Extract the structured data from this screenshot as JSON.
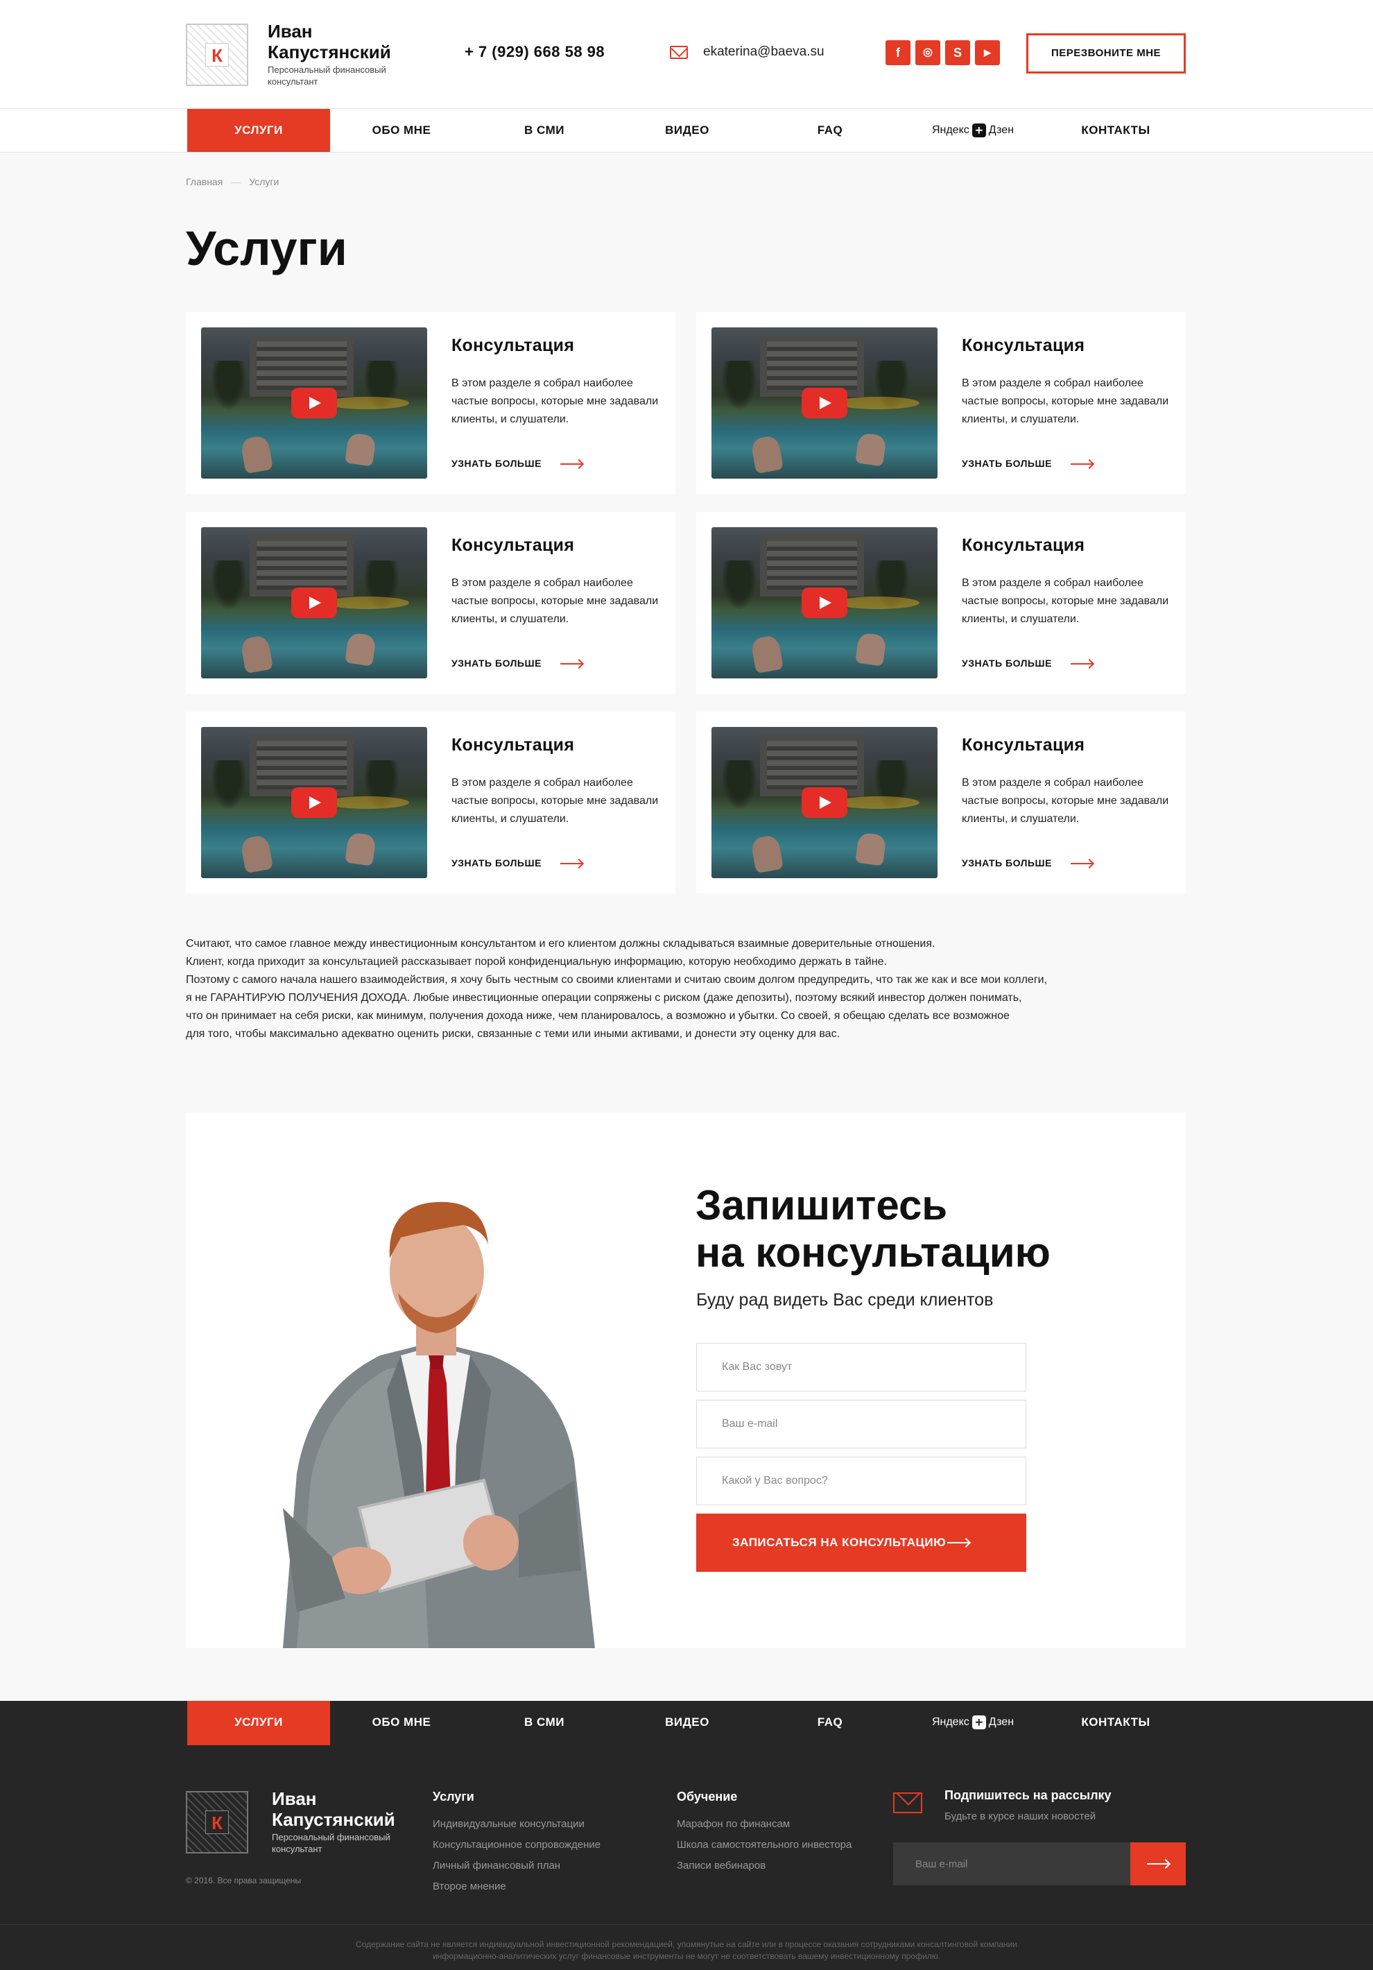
{
  "header": {
    "logo_letter": "К",
    "name": "Иван Капустянский",
    "subtitle": "Персональный финансовый консультант",
    "phone": "+ 7 (929) 668 58 98",
    "email": "ekaterina@baeva.su",
    "social": [
      {
        "icon": "facebook-icon",
        "glyph": "f"
      },
      {
        "icon": "instagram-icon",
        "glyph": "◎"
      },
      {
        "icon": "skype-icon",
        "glyph": "S"
      },
      {
        "icon": "youtube-icon",
        "glyph": "▶"
      }
    ],
    "callback_label": "ПЕРЕЗВОНИТЕ МНЕ"
  },
  "nav": {
    "items": [
      "УСЛУГИ",
      "ОБО МНЕ",
      "В СМИ",
      "ВИДЕО",
      "FAQ"
    ],
    "zen_left": "Яндекс",
    "zen_right": "Дзен",
    "contacts": "КОНТАКТЫ",
    "active": "УСЛУГИ"
  },
  "breadcrumb": {
    "home": "Главная",
    "sep": "—",
    "current": "Услуги"
  },
  "page_title": "Услуги",
  "cards": [
    {
      "title": "Консультация",
      "text": "В этом разделе я собрал наиболее частые вопросы, которые мне задавали клиенты, и слушатели.",
      "more": "УЗНАТЬ БОЛЬШЕ"
    },
    {
      "title": "Консультация",
      "text": "В этом разделе я собрал наиболее частые вопросы, которые мне задавали клиенты, и слушатели.",
      "more": "УЗНАТЬ БОЛЬШЕ"
    },
    {
      "title": "Консультация",
      "text": "В этом разделе я собрал наиболее частые вопросы, которые мне задавали клиенты, и слушатели.",
      "more": "УЗНАТЬ БОЛЬШЕ"
    },
    {
      "title": "Консультация",
      "text": "В этом разделе я собрал наиболее частые вопросы, которые мне задавали клиенты, и слушатели.",
      "more": "УЗНАТЬ БОЛЬШЕ"
    },
    {
      "title": "Консультация",
      "text": "В этом разделе я собрал наиболее частые вопросы, которые мне задавали клиенты, и слушатели.",
      "more": "УЗНАТЬ БОЛЬШЕ"
    },
    {
      "title": "Консультация",
      "text": "В этом разделе я собрал наиболее частые вопросы, которые мне задавали клиенты, и слушатели.",
      "more": "УЗНАТЬ БОЛЬШЕ"
    }
  ],
  "paragraph": [
    "Считают, что самое главное между инвестиционным консультантом и его клиентом должны складываться взаимные доверительные отношения.",
    "Клиент, когда приходит за консультацией рассказывает порой конфиденциальную информацию, которую необходимо держать в тайне.",
    "Поэтому с самого начала нашего взаимодействия, я хочу быть честным со своими клиентами и считаю своим долгом предупредить, что так же как и все мои коллеги,",
    "я не ГАРАНТИРУЮ ПОЛУЧЕНИЯ ДОХОДА. Любые инвестиционные операции сопряжены с риском (даже депозиты), поэтому всякий инвестор должен понимать,",
    "что он принимает на себя риски, как минимум, получения дохода ниже, чем планировалось, а возможно и убытки. Со своей, я обещаю сделать все возможное",
    "для того, чтобы максимально адекватно оценить риски, связанные с теми или иными активами, и донести эту оценку для вас."
  ],
  "cta": {
    "title_line1": "Запишитесь",
    "title_line2": "на консультацию",
    "subtitle": "Буду рад видеть Вас среди клиентов",
    "name_placeholder": "Как Вас зовут",
    "email_placeholder": "Ваш e-mail",
    "question_placeholder": "Какой у Вас вопрос?",
    "button": "ЗАПИСАТЬСЯ НА КОНСУЛЬТАЦИЮ"
  },
  "footer": {
    "name": "Иван Капустянский",
    "subtitle": "Персональный финансовый консультант",
    "copyright": "© 2016. Все права защищены",
    "services": {
      "title": "Услуги",
      "items": [
        "Индивидуальные консультации",
        "Консультационное сопровождение",
        "Личный финансовый план",
        "Второе мнение"
      ]
    },
    "education": {
      "title": "Обучение",
      "items": [
        "Марафон по финансам",
        "Школа самостоятельного инвестора",
        "Записи вебинаров"
      ]
    },
    "subscribe": {
      "title": "Подпишитесь на рассылку",
      "text": "Будьте в курсе наших новостей",
      "placeholder": "Ваш e-mail"
    },
    "disclaimer_line1": "Содержание сайта не является индивидуальной инвестиционной рекомендацией, упомянутые на сайте или в процессе оказания сотрудниками консалтинговой компании",
    "disclaimer_line2": "информационно-аналитических услуг финансовые инструменты не могут не соответствовать вашему инвестиционному профилю."
  },
  "colors": {
    "accent": "#e53a24",
    "dark": "#262626",
    "page_bg": "#f8f8f8"
  }
}
